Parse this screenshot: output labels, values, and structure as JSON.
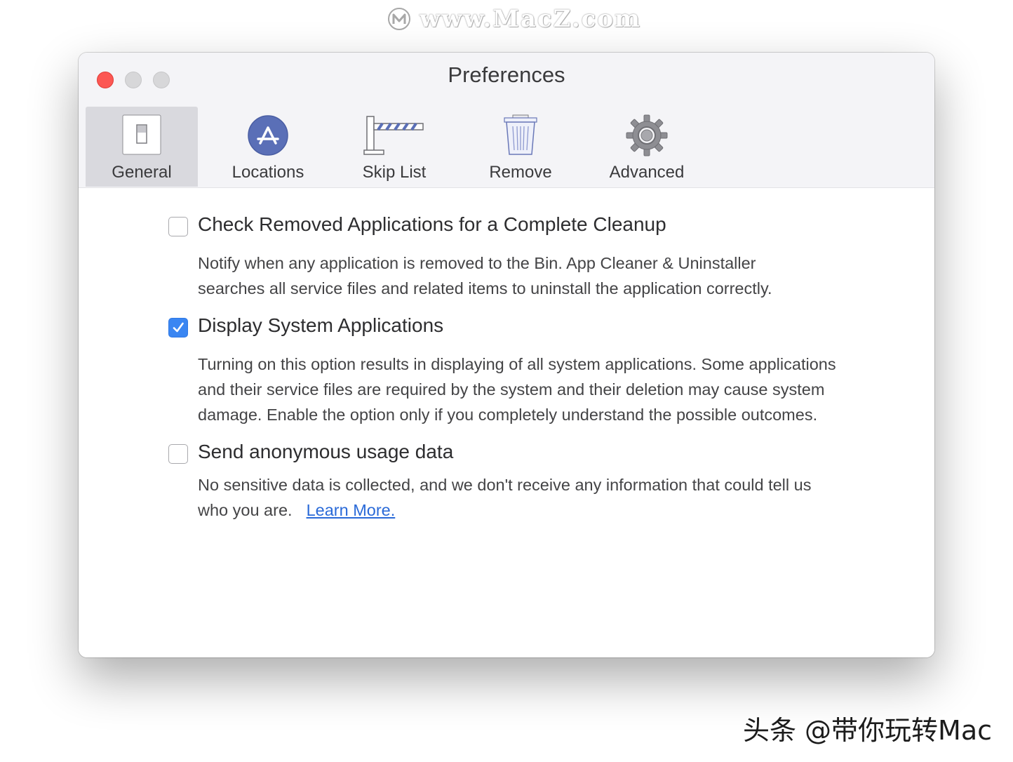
{
  "watermark_top": "www.MacZ.com",
  "watermark_bottom": "头条 @带你玩转Mac",
  "window": {
    "title": "Preferences"
  },
  "toolbar": {
    "tabs": [
      {
        "label": "General",
        "icon": "switch-icon",
        "selected": true
      },
      {
        "label": "Locations",
        "icon": "app-store-icon",
        "selected": false
      },
      {
        "label": "Skip List",
        "icon": "barrier-gate-icon",
        "selected": false
      },
      {
        "label": "Remove",
        "icon": "trash-icon",
        "selected": false
      },
      {
        "label": "Advanced",
        "icon": "gear-icon",
        "selected": false
      }
    ]
  },
  "options": [
    {
      "title": "Check Removed Applications for a Complete Cleanup",
      "checked": false,
      "desc_lines": [
        "Notify when any application is removed to the Bin. App Cleaner & Uninstaller",
        "searches all service files and related items to uninstall the application correctly."
      ]
    },
    {
      "title": "Display System Applications",
      "checked": true,
      "desc_lines": [
        "Turning on this option results in displaying of all system applications. Some applications",
        "and their service files are required by the system and their deletion may cause system",
        "damage. Enable the option only if you completely understand the possible outcomes."
      ]
    },
    {
      "title": "Send anonymous usage data",
      "checked": false,
      "desc_lines": [
        "No sensitive data is collected, and we don't receive any information that could tell us",
        "who you are."
      ],
      "link": "Learn More."
    }
  ],
  "colors": {
    "accent": "#3a86f2",
    "link": "#2a6ad8",
    "close_button": "#fc5753"
  }
}
